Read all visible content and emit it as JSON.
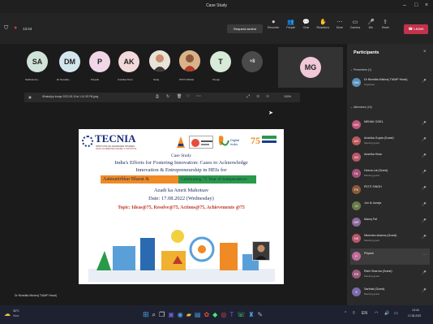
{
  "window": {
    "title": "Case Study"
  },
  "meeting": {
    "timer": "13:44",
    "request_control": "Request control"
  },
  "toolbar": {
    "buttons": [
      {
        "label": "Recorder",
        "icon": "recorder-icon"
      },
      {
        "label": "People",
        "icon": "people-icon"
      },
      {
        "label": "Chat",
        "icon": "chat-icon"
      },
      {
        "label": "Reactions",
        "icon": "reactions-icon"
      },
      {
        "label": "More",
        "icon": "more-icon"
      },
      {
        "label": "Camera",
        "icon": "camera-icon"
      },
      {
        "label": "Mic",
        "icon": "mic-icon"
      },
      {
        "label": "Share",
        "icon": "share-icon"
      }
    ],
    "leave_label": "Leave"
  },
  "gallery": [
    {
      "initials": "SA",
      "name": "Sarthak Aro...",
      "color": "#cfe3d8"
    },
    {
      "initials": "DM",
      "name": "Dr Nivedita...",
      "color": "#d3e6ee"
    },
    {
      "initials": "P",
      "name": "Priyank",
      "color": "#f0d6e6"
    },
    {
      "initials": "AK",
      "name": "Anshika Khan",
      "color": "#f3d9da"
    },
    {
      "initials": "",
      "name": "Suraj",
      "color": "#8a7a6a"
    },
    {
      "initials": "",
      "name": "PIOTI SINGH",
      "color": "#b98a6a"
    },
    {
      "initials": "T",
      "name": "Tanuja",
      "color": "#d8ead8"
    },
    {
      "initials": "+8",
      "name": "",
      "color": "#4a4a4a"
    }
  ],
  "self_view": {
    "initials": "MG",
    "color": "#f0c8d8"
  },
  "share_bar": {
    "filename": "WhatsApp Image 2022-08-15 at 1.41.39 PM.jpeg",
    "zoom": "100%"
  },
  "slide": {
    "logo_name": "TECNIA",
    "logo_sub1": "INSTITUTE OF ADVANCED STUDIES",
    "logo_sub2": "NAAC ACCREDITED GRADE 'A' INSTITUTE",
    "case_study": "Case Study",
    "line1": "India's Efforts for Fostering Innovation: Cases to Acknowledge",
    "line2": "Innovation & Entrepreneurship in HEIs for",
    "banner_left": "Aatmanirbhar Bharat &",
    "banner_right": "Celebrating 75 Year of Independence",
    "azadi": "Azadi ka Amrit Mahotsav",
    "date": "Date: 17.08.2022 (Wednesday)",
    "topic": "Topic: Ideas@75, Resolve@75, Actions@75, Achievements @75"
  },
  "presenter_label": "Dr Nivedita Mishra( TIAMP Head)",
  "participants": {
    "title": "Participants",
    "presenters_header": "Presenters (1)",
    "attendees_header": "Attendees (15)",
    "presenter": {
      "name": "Dr Nivedita Mishra( TIAMP Head)",
      "sub": "Organiser",
      "initials": "DM",
      "color": "#5a8fb8"
    },
    "attendees": [
      {
        "name": "MEHAK GOEL",
        "sub": "",
        "initials": "MG",
        "color": "#c0567a"
      },
      {
        "name": "Anshika Gupta (Guest)",
        "sub": "Meeting guest",
        "initials": "AG",
        "color": "#b85a5a"
      },
      {
        "name": "Anshika Khan",
        "sub": "",
        "initials": "AK",
        "color": "#b8586a"
      },
      {
        "name": "Heena Lal (Guest)",
        "sub": "Meeting guest",
        "initials": "HL",
        "color": "#a8507a"
      },
      {
        "name": "PIOTI SINGH",
        "sub": "",
        "initials": "PS",
        "color": "#8a5a3a"
      },
      {
        "name": "Jun Ik Juneja",
        "sub": "",
        "initials": "JJ",
        "color": "#6a7a4a"
      },
      {
        "name": "Manoj Pal",
        "sub": "",
        "initials": "MP",
        "color": "#8a6a9a"
      },
      {
        "name": "Nivendra sharma (Guest)",
        "sub": "Meeting guest",
        "initials": "NS",
        "color": "#b8566a"
      },
      {
        "name": "Priyank",
        "sub": "",
        "initials": "P",
        "color": "#c06a9a"
      },
      {
        "name": "Rishi Sharma (Guest)",
        "sub": "Meeting guest",
        "initials": "RS",
        "color": "#9a5a7a"
      },
      {
        "name": "Sarthak (Guest)",
        "sub": "Meeting guest",
        "initials": "S",
        "color": "#7a6aaa"
      }
    ]
  },
  "taskbar": {
    "weather_temp": "30°C",
    "weather_desc": "Haze",
    "time": "13:44",
    "date": "17-08-2022"
  }
}
